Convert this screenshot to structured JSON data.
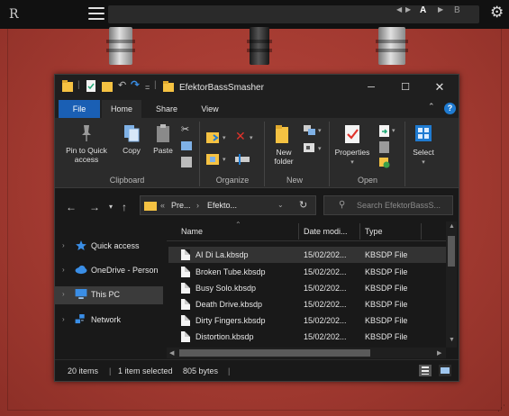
{
  "host": {
    "logo": "R",
    "preset_name": "",
    "ab_a": "A",
    "ab_b": "B"
  },
  "window": {
    "title": "EfektorBassSmasher",
    "quick_access_sep": "="
  },
  "ribbon": {
    "tabs": [
      "File",
      "Home",
      "Share",
      "View"
    ],
    "clipboard": {
      "pin_label_1": "Pin to Quick",
      "pin_label_2": "access",
      "copy": "Copy",
      "paste": "Paste",
      "group": "Clipboard"
    },
    "organize": {
      "group": "Organize"
    },
    "new": {
      "folder_label_1": "New",
      "folder_label_2": "folder",
      "group": "New"
    },
    "open": {
      "properties": "Properties",
      "group": "Open"
    },
    "select": {
      "label": "Select"
    }
  },
  "address": {
    "crumb_overflow": "«",
    "crumb_1": "Pre...",
    "crumb_sep": "›",
    "crumb_2": "Efekto...",
    "search_placeholder": "Search EfektorBassS..."
  },
  "nav_pane": {
    "items": [
      {
        "label": "Quick access"
      },
      {
        "label": "OneDrive - Person"
      },
      {
        "label": "This PC"
      },
      {
        "label": "Network"
      }
    ]
  },
  "file_list": {
    "columns": [
      "Name",
      "Date modi...",
      "Type"
    ],
    "rows": [
      {
        "name": "AI Di La.kbsdp",
        "date": "15/02/202...",
        "type": "KBSDP File"
      },
      {
        "name": "Broken Tube.kbsdp",
        "date": "15/02/202...",
        "type": "KBSDP File"
      },
      {
        "name": "Busy Solo.kbsdp",
        "date": "15/02/202...",
        "type": "KBSDP File"
      },
      {
        "name": "Death Drive.kbsdp",
        "date": "15/02/202...",
        "type": "KBSDP File"
      },
      {
        "name": "Dirty Fingers.kbsdp",
        "date": "15/02/202...",
        "type": "KBSDP File"
      },
      {
        "name": "Distortion.kbsdp",
        "date": "15/02/202...",
        "type": "KBSDP File"
      }
    ]
  },
  "status_bar": {
    "count": "20 items",
    "selection": "1 item selected",
    "size": "805 bytes"
  },
  "colors": {
    "plugin_bg": "#a8382f",
    "explorer_bg": "#191919",
    "accent_blue": "#1a5fb4",
    "folder_yellow": "#f5c242"
  }
}
